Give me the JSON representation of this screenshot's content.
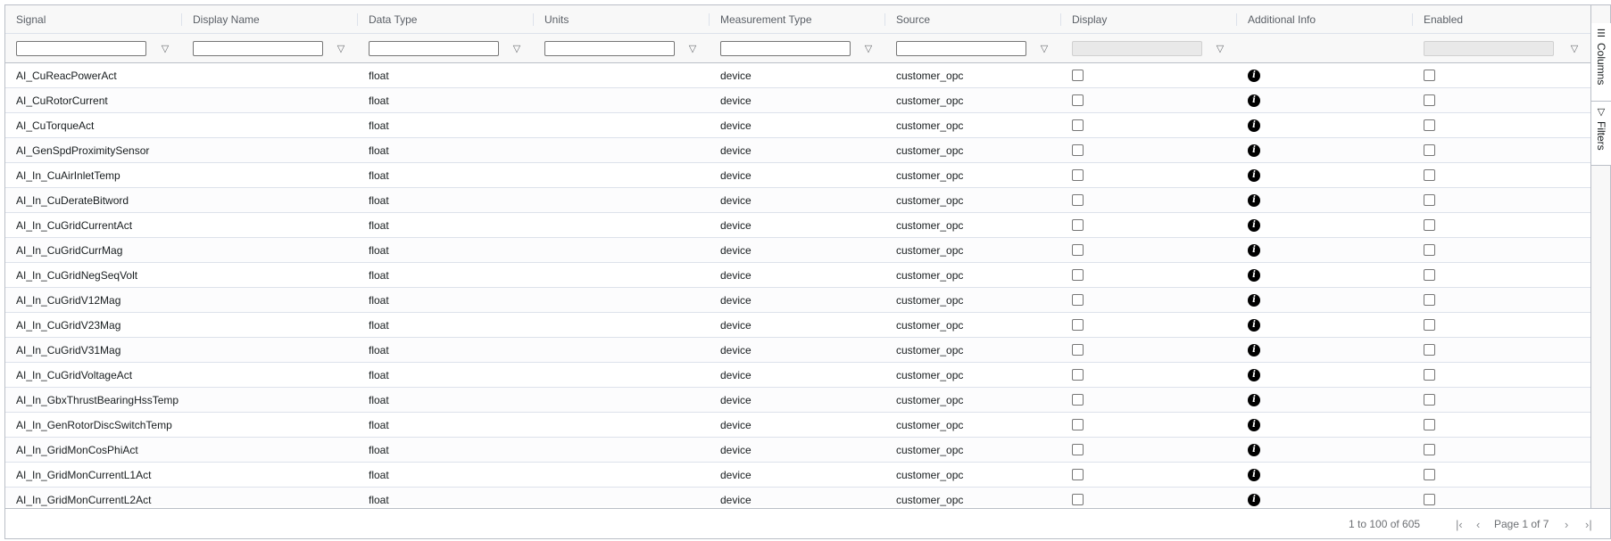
{
  "columns": [
    {
      "label": "Signal"
    },
    {
      "label": "Display Name"
    },
    {
      "label": "Data Type"
    },
    {
      "label": "Units"
    },
    {
      "label": "Measurement Type"
    },
    {
      "label": "Source"
    },
    {
      "label": "Display"
    },
    {
      "label": "Additional Info"
    },
    {
      "label": "Enabled"
    }
  ],
  "filters": {
    "signal": "",
    "display_name": "",
    "data_type": "",
    "units": "",
    "measurement_type": "",
    "source": "",
    "display": "",
    "enabled": ""
  },
  "rows": [
    {
      "signal": "AI_CuReacPowerAct",
      "display_name": "",
      "data_type": "float",
      "units": "",
      "measurement_type": "device",
      "source": "customer_opc"
    },
    {
      "signal": "AI_CuRotorCurrent",
      "display_name": "",
      "data_type": "float",
      "units": "",
      "measurement_type": "device",
      "source": "customer_opc"
    },
    {
      "signal": "AI_CuTorqueAct",
      "display_name": "",
      "data_type": "float",
      "units": "",
      "measurement_type": "device",
      "source": "customer_opc"
    },
    {
      "signal": "AI_GenSpdProximitySensor",
      "display_name": "",
      "data_type": "float",
      "units": "",
      "measurement_type": "device",
      "source": "customer_opc"
    },
    {
      "signal": "AI_In_CuAirInletTemp",
      "display_name": "",
      "data_type": "float",
      "units": "",
      "measurement_type": "device",
      "source": "customer_opc"
    },
    {
      "signal": "AI_In_CuDerateBitword",
      "display_name": "",
      "data_type": "float",
      "units": "",
      "measurement_type": "device",
      "source": "customer_opc"
    },
    {
      "signal": "AI_In_CuGridCurrentAct",
      "display_name": "",
      "data_type": "float",
      "units": "",
      "measurement_type": "device",
      "source": "customer_opc"
    },
    {
      "signal": "AI_In_CuGridCurrMag",
      "display_name": "",
      "data_type": "float",
      "units": "",
      "measurement_type": "device",
      "source": "customer_opc"
    },
    {
      "signal": "AI_In_CuGridNegSeqVolt",
      "display_name": "",
      "data_type": "float",
      "units": "",
      "measurement_type": "device",
      "source": "customer_opc"
    },
    {
      "signal": "AI_In_CuGridV12Mag",
      "display_name": "",
      "data_type": "float",
      "units": "",
      "measurement_type": "device",
      "source": "customer_opc"
    },
    {
      "signal": "AI_In_CuGridV23Mag",
      "display_name": "",
      "data_type": "float",
      "units": "",
      "measurement_type": "device",
      "source": "customer_opc"
    },
    {
      "signal": "AI_In_CuGridV31Mag",
      "display_name": "",
      "data_type": "float",
      "units": "",
      "measurement_type": "device",
      "source": "customer_opc"
    },
    {
      "signal": "AI_In_CuGridVoltageAct",
      "display_name": "",
      "data_type": "float",
      "units": "",
      "measurement_type": "device",
      "source": "customer_opc"
    },
    {
      "signal": "AI_In_GbxThrustBearingHssTemp",
      "display_name": "",
      "data_type": "float",
      "units": "",
      "measurement_type": "device",
      "source": "customer_opc"
    },
    {
      "signal": "AI_In_GenRotorDiscSwitchTemp",
      "display_name": "",
      "data_type": "float",
      "units": "",
      "measurement_type": "device",
      "source": "customer_opc"
    },
    {
      "signal": "AI_In_GridMonCosPhiAct",
      "display_name": "",
      "data_type": "float",
      "units": "",
      "measurement_type": "device",
      "source": "customer_opc"
    },
    {
      "signal": "AI_In_GridMonCurrentL1Act",
      "display_name": "",
      "data_type": "float",
      "units": "",
      "measurement_type": "device",
      "source": "customer_opc"
    },
    {
      "signal": "AI_In_GridMonCurrentL2Act",
      "display_name": "",
      "data_type": "float",
      "units": "",
      "measurement_type": "device",
      "source": "customer_opc"
    }
  ],
  "sidebar": {
    "columns_label": "Columns",
    "filters_label": "Filters"
  },
  "footer": {
    "summary": "1 to 100 of 605",
    "page_text": "Page 1 of 7"
  },
  "icons": {
    "filter": "filter-icon",
    "info": "info-circle-icon",
    "columns": "columns-icon",
    "first": "first-page-icon",
    "prev": "previous-page-icon",
    "next": "next-page-icon",
    "last": "last-page-icon"
  }
}
